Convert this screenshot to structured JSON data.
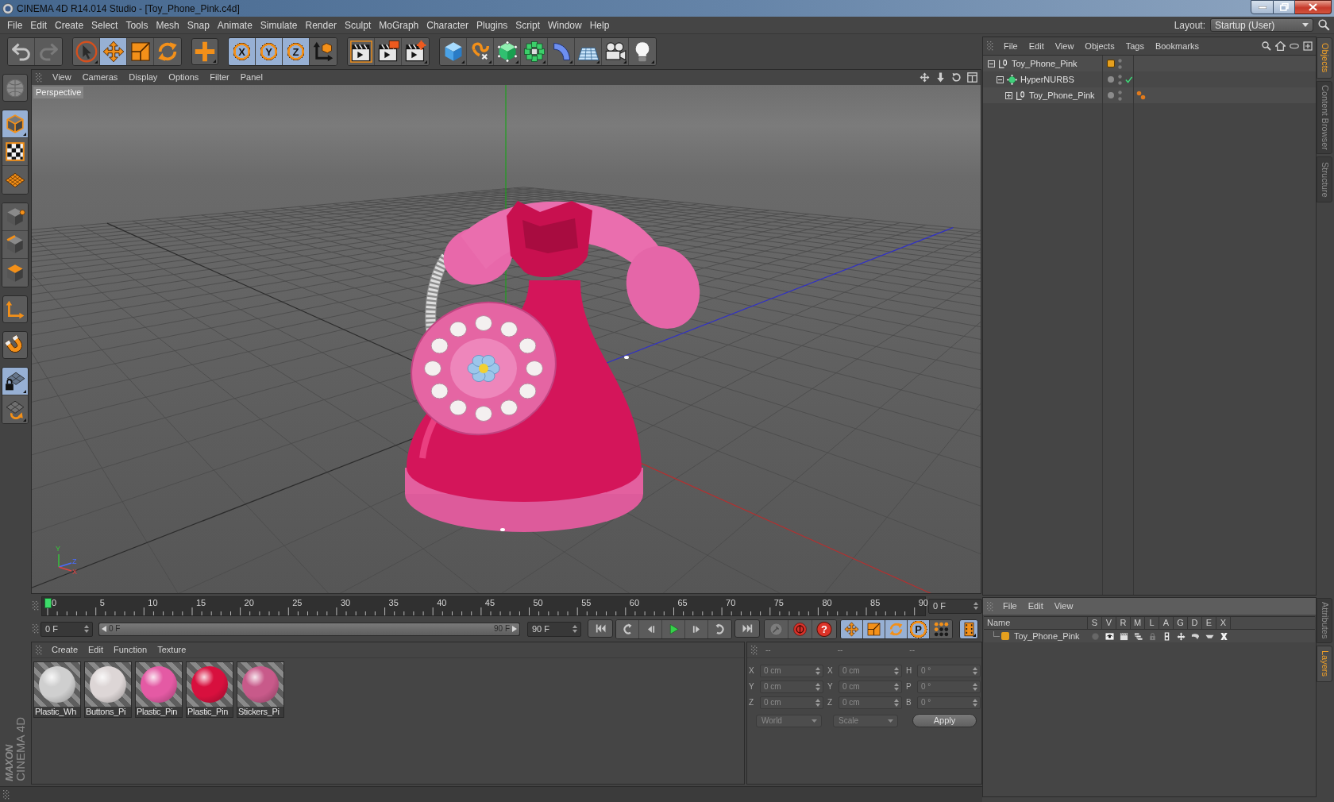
{
  "window": {
    "title": "CINEMA 4D R14.014 Studio - [Toy_Phone_Pink.c4d]"
  },
  "menu_bar": {
    "items": [
      "File",
      "Edit",
      "Create",
      "Select",
      "Tools",
      "Mesh",
      "Snap",
      "Animate",
      "Simulate",
      "Render",
      "Sculpt",
      "MoGraph",
      "Character",
      "Plugins",
      "Script",
      "Window",
      "Help"
    ],
    "layout_label": "Layout:",
    "layout_value": "Startup (User)"
  },
  "toolbar": {
    "history": [
      {
        "kind": "undo",
        "disabled": false
      },
      {
        "kind": "redo",
        "disabled": true
      }
    ],
    "groups": [
      {
        "items": [
          {
            "kind": "select",
            "selected": false
          },
          {
            "kind": "move",
            "selected": true
          },
          {
            "kind": "scale",
            "selected": false
          },
          {
            "kind": "rotate",
            "selected": false
          }
        ]
      },
      {
        "items": [
          {
            "kind": "last_tool"
          }
        ]
      },
      {
        "items": [
          {
            "kind": "axis",
            "label": "X",
            "selected": true
          },
          {
            "kind": "axis",
            "label": "Y",
            "selected": true
          },
          {
            "kind": "axis",
            "label": "Z",
            "selected": true
          },
          {
            "kind": "coordinates"
          }
        ]
      },
      {
        "items": [
          {
            "kind": "render_view"
          },
          {
            "kind": "render_picture"
          },
          {
            "kind": "render_settings"
          }
        ]
      },
      {
        "items": [
          {
            "kind": "cube"
          },
          {
            "kind": "spline"
          },
          {
            "kind": "nurbs"
          },
          {
            "kind": "cloner"
          },
          {
            "kind": "deformer"
          },
          {
            "kind": "floor"
          },
          {
            "kind": "camera"
          },
          {
            "kind": "light"
          }
        ]
      }
    ]
  },
  "left_toolbar": {
    "groups": [
      {
        "items": [
          {
            "kind": "make_editable"
          }
        ]
      },
      {
        "items": [
          {
            "kind": "model",
            "selected": true
          },
          {
            "kind": "texture",
            "selected": false
          },
          {
            "kind": "workplane",
            "selected": false
          }
        ]
      },
      {
        "items": [
          {
            "kind": "points",
            "selected": false
          },
          {
            "kind": "edges",
            "selected": false
          },
          {
            "kind": "polygons",
            "selected": false
          }
        ]
      },
      {
        "items": [
          {
            "kind": "axis_mode",
            "selected": false
          }
        ]
      },
      {
        "items": [
          {
            "kind": "snap",
            "selected": false
          }
        ]
      },
      {
        "items": [
          {
            "kind": "workplane_lock",
            "selected": true
          },
          {
            "kind": "workplane_rotate"
          }
        ]
      }
    ],
    "logo": {
      "brand": "MAXON",
      "product": "CINEMA 4D"
    }
  },
  "viewport": {
    "menu": [
      "View",
      "Cameras",
      "Display",
      "Options",
      "Filter",
      "Panel"
    ],
    "camera": "Perspective",
    "axis_labels": [
      "Y",
      "Z",
      "X"
    ]
  },
  "timeline": {
    "ticks": [
      "0",
      "5",
      "10",
      "15",
      "20",
      "25",
      "30",
      "35",
      "40",
      "45",
      "50",
      "55",
      "60",
      "65",
      "70",
      "75",
      "80",
      "85",
      "90"
    ],
    "playhead": {
      "level": 0
    },
    "current_frame": "0 F"
  },
  "transport": {
    "start": "0 F",
    "range": {
      "level": 1,
      "start": "0 F",
      "end": "90 F"
    },
    "end": "90 F",
    "playback": [
      {
        "items": [
          {
            "kind": "first"
          }
        ]
      },
      {
        "items": [
          {
            "kind": "prev_key"
          },
          {
            "kind": "prev_frame"
          },
          {
            "kind": "play"
          },
          {
            "kind": "next_frame"
          },
          {
            "kind": "next_key"
          }
        ]
      },
      {
        "items": [
          {
            "kind": "last"
          }
        ]
      }
    ],
    "record": [
      {
        "kind": "record_key"
      },
      {
        "kind": "autokey"
      },
      {
        "kind": "key_help",
        "label": "?"
      }
    ],
    "channels": [
      {
        "kind": "position",
        "selected": true
      },
      {
        "kind": "scale",
        "selected": true
      },
      {
        "kind": "rotation",
        "selected": true
      },
      {
        "kind": "parameter",
        "label": "P",
        "selected": true
      },
      {
        "kind": "pla",
        "selected": false
      }
    ],
    "timeline_button": {
      "kind": "timeline",
      "selected": true
    }
  },
  "material_manager": {
    "menu": [
      "Create",
      "Edit",
      "Function",
      "Texture"
    ],
    "materials": [
      {
        "name": "Plastic_Wh",
        "color": "#cfcfcf"
      },
      {
        "name": "Buttons_Pi",
        "color": "#ddd6d6"
      },
      {
        "name": "Plastic_Pin",
        "color": "#e45aa4"
      },
      {
        "name": "Plastic_Pin",
        "color": "#d8103e"
      },
      {
        "name": "Stickers_Pi",
        "color": "#c85a8a"
      }
    ]
  },
  "coordinates": {
    "headers": [
      "--",
      "--",
      "--"
    ],
    "rows": [
      {
        "position_axis": "X",
        "position": "0 cm",
        "size_axis": "X",
        "size": "0 cm",
        "rotation_axis": "H",
        "rotation": "0 °"
      },
      {
        "position_axis": "Y",
        "position": "0 cm",
        "size_axis": "Y",
        "size": "0 cm",
        "rotation_axis": "P",
        "rotation": "0 °"
      },
      {
        "position_axis": "Z",
        "position": "0 cm",
        "size_axis": "Z",
        "size": "0 cm",
        "rotation_axis": "B",
        "rotation": "0 °"
      }
    ],
    "space": "World",
    "mode": "Scale",
    "apply": "Apply"
  },
  "object_manager": {
    "menu": [
      "File",
      "Edit",
      "View",
      "Objects",
      "Tags",
      "Bookmarks"
    ],
    "tree": [
      {
        "name": "Toy_Phone_Pink",
        "kind": "null",
        "expanded": true,
        "color": "#e6a01e",
        "children": [
          {
            "name": "HyperNURBS",
            "kind": "nurbs",
            "expanded": true,
            "enabled": true,
            "children": [
              {
                "name": "Toy_Phone_Pink",
                "kind": "null",
                "expanded": false,
                "tags": [
                  {
                    "kind": "material"
                  }
                ]
              }
            ]
          }
        ]
      }
    ]
  },
  "layer_manager": {
    "menu": [
      "File",
      "Edit",
      "View"
    ],
    "columns": [
      "Name",
      "S",
      "V",
      "R",
      "M",
      "L",
      "A",
      "G",
      "D",
      "E",
      "X"
    ],
    "layers": [
      {
        "name": "Toy_Phone_Pink",
        "color": "#e6a01e",
        "flags": [
          {
            "kind": "solo",
            "on": false
          },
          {
            "kind": "view",
            "on": true
          },
          {
            "kind": "render",
            "on": true
          },
          {
            "kind": "manager",
            "on": true
          },
          {
            "kind": "lock",
            "on": false
          },
          {
            "kind": "animation",
            "on": true
          },
          {
            "kind": "generators",
            "on": true
          },
          {
            "kind": "deformers",
            "on": true
          },
          {
            "kind": "expressions",
            "on": true
          },
          {
            "kind": "xref",
            "on": true
          }
        ]
      }
    ]
  },
  "side_tabs": {
    "top": [
      {
        "label": "Objects",
        "selected": true
      },
      {
        "label": "Content Browser",
        "selected": false
      },
      {
        "label": "Structure",
        "selected": false
      }
    ],
    "bottom": [
      {
        "label": "Attributes",
        "selected": false
      },
      {
        "label": "Layers",
        "selected": true
      }
    ]
  }
}
